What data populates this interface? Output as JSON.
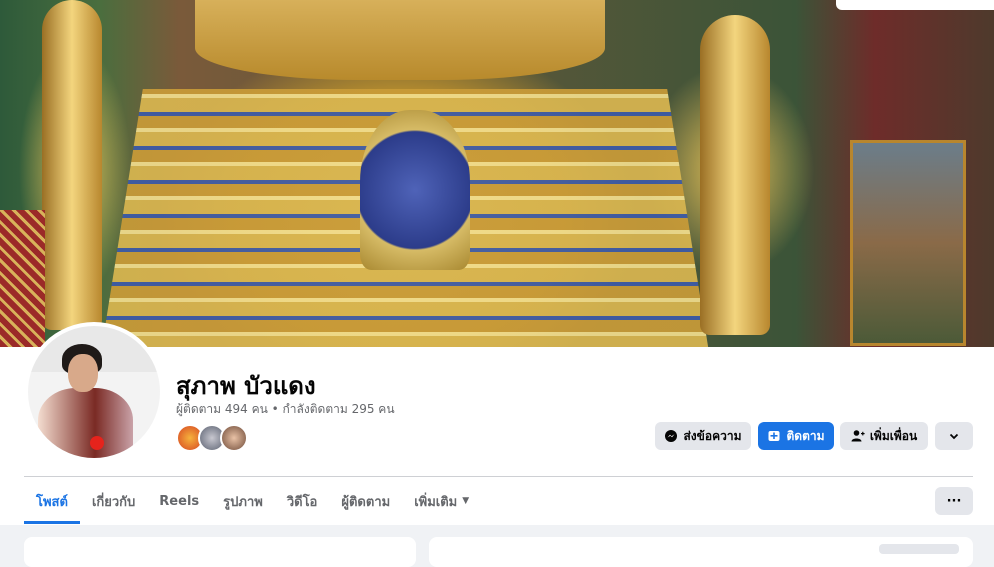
{
  "profile": {
    "name": "สุภาพ บัวแดง",
    "stats": "ผู้ติดตาม 494 คน • กำลังติดตาม 295 คน"
  },
  "actions": {
    "message_label": "ส่งข้อความ",
    "follow_label": "ติดตาม",
    "add_friend_label": "เพิ่มเพื่อน"
  },
  "tabs": [
    {
      "label": "โพสต์",
      "active": true
    },
    {
      "label": "เกี่ยวกับ"
    },
    {
      "label": "Reels"
    },
    {
      "label": "รูปภาพ"
    },
    {
      "label": "วิดีโอ"
    },
    {
      "label": "ผู้ติดตาม"
    },
    {
      "label": "เพิ่มเติม",
      "dropdown": true
    }
  ],
  "colors": {
    "accent": "#1b74e4",
    "button_grey": "#e4e6eb",
    "secondary_text": "#65676b",
    "page_bg": "#f0f2f5"
  },
  "icons": {
    "message": "messenger-icon",
    "follow": "follow-icon",
    "add_friend": "person-add-icon",
    "more": "chevron-down-icon",
    "tab_more": "ellipsis-icon"
  }
}
